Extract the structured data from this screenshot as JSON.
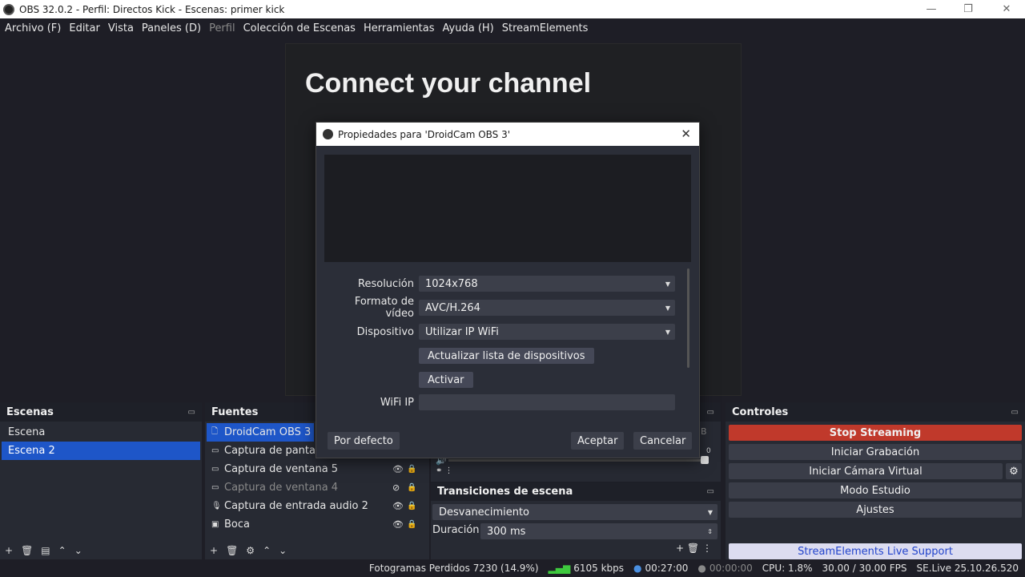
{
  "window": {
    "title": "OBS 32.0.2 - Perfil: Directos Kick - Escenas: primer kick"
  },
  "menu": [
    "Archivo (F)",
    "Editar",
    "Vista",
    "Paneles (D)",
    "Perfil",
    "Colección de Escenas",
    "Herramientas",
    "Ayuda (H)",
    "StreamElements"
  ],
  "preview": {
    "heading": "Connect your channel"
  },
  "scenes": {
    "title": "Escenas",
    "items": [
      "Escena",
      "Escena 2"
    ]
  },
  "sources": {
    "title": "Fuentes",
    "items": [
      "DroidCam OBS 3",
      "Captura de pantalla",
      "Captura de ventana 5",
      "Captura de ventana 4",
      "Captura de entrada audio 2",
      "Boca"
    ]
  },
  "mixer": {
    "db_label": "dB",
    "db_value": "0"
  },
  "transitions": {
    "title": "Transiciones de escena",
    "selected": "Desvanecimiento",
    "duration_label": "Duración",
    "duration_value": "300 ms"
  },
  "controls": {
    "title": "Controles",
    "stop": "Stop Streaming",
    "record": "Iniciar Grabación",
    "virtual": "Iniciar Cámara Virtual",
    "studio": "Modo Estudio",
    "settings": "Ajustes",
    "se_support": "StreamElements Live Support"
  },
  "status": {
    "dropped": "Fotogramas Perdidos 7230 (14.9%)",
    "bitrate": "6105 kbps",
    "stream_time": "00:27:00",
    "rec_time": "00:00:00",
    "cpu": "CPU: 1.8%",
    "fps": "30.00 / 30.00 FPS",
    "selive": "SE.Live 25.10.26.520"
  },
  "dialog": {
    "title": "Propiedades para 'DroidCam OBS 3'",
    "resolution_label": "Resolución",
    "resolution_value": "1024x768",
    "format_label": "Formato de vídeo",
    "format_value": "AVC/H.264",
    "device_label": "Dispositivo",
    "device_value": "Utilizar IP WiFi",
    "refresh_button": "Actualizar lista de dispositivos",
    "activate_button": "Activar",
    "wifi_label": "WiFi IP",
    "wifi_value": "",
    "default_button": "Por defecto",
    "ok_button": "Aceptar",
    "cancel_button": "Cancelar"
  }
}
